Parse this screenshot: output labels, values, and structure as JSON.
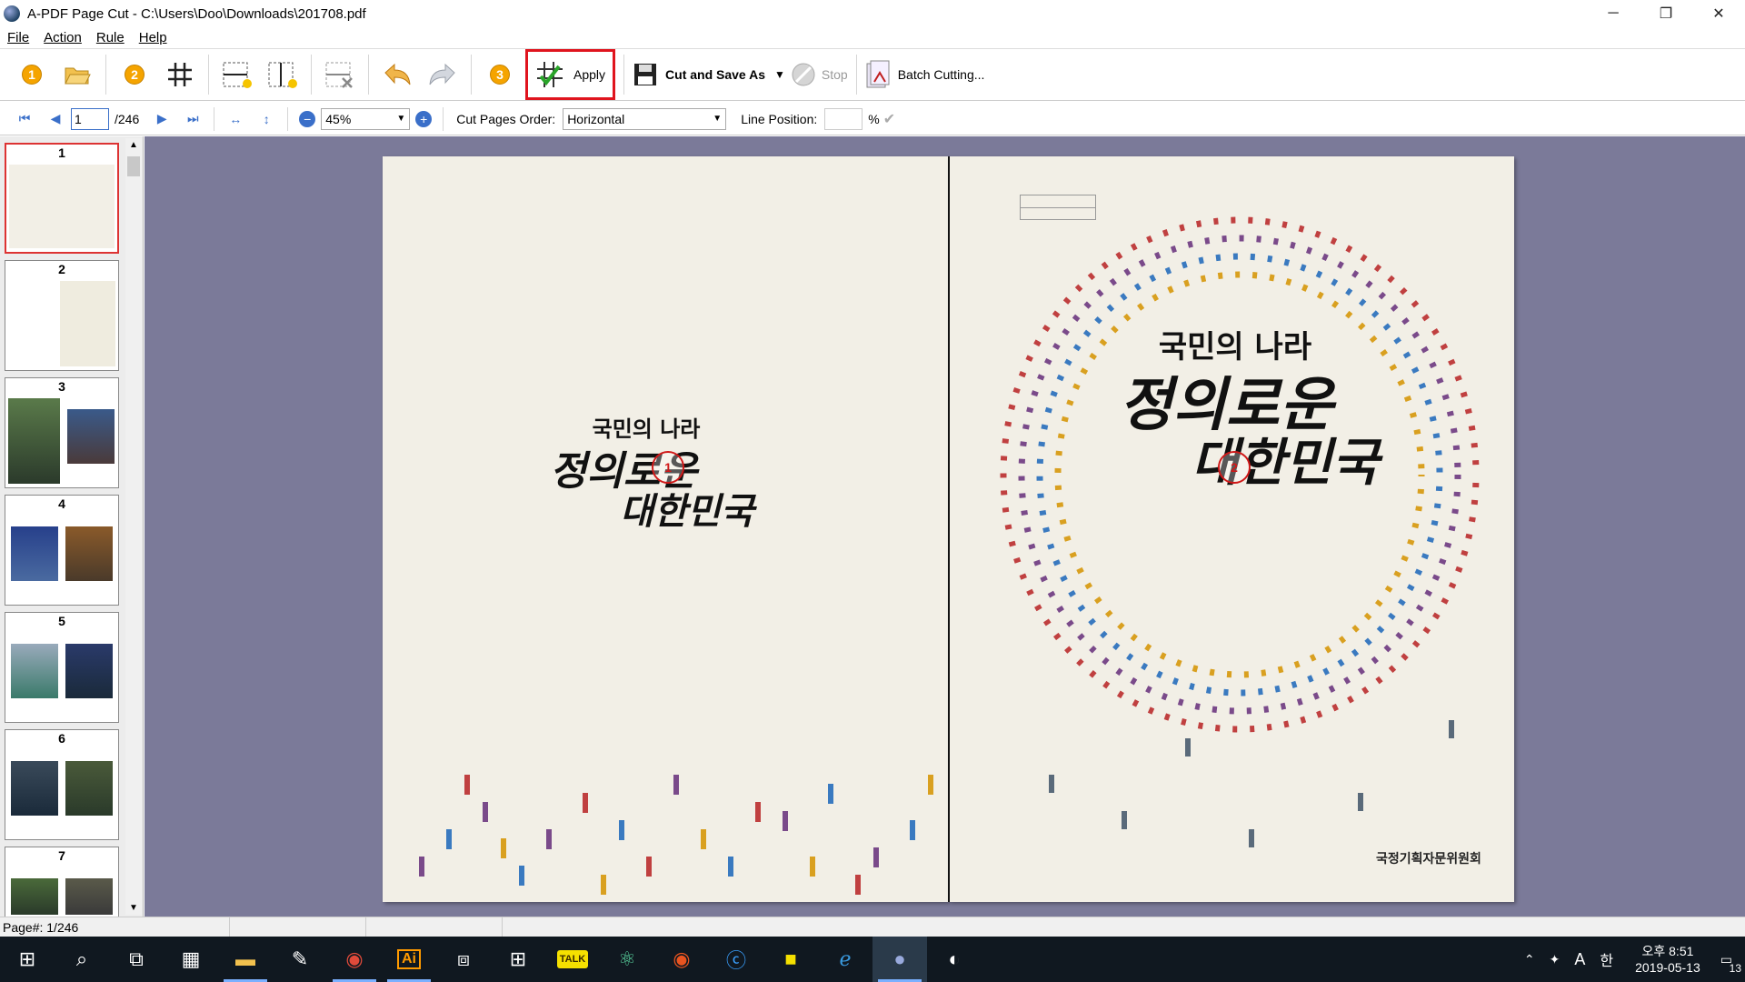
{
  "window": {
    "title": "A-PDF Page Cut - C:\\Users\\Doo\\Downloads\\201708.pdf",
    "minimize": "─",
    "restore": "❐",
    "close": "✕"
  },
  "menu": {
    "items": [
      "File",
      "Action",
      "Rule",
      "Help"
    ]
  },
  "toolbar": {
    "step1": "1",
    "step2": "2",
    "step3": "3",
    "apply": "Apply",
    "cut_and_save": "Cut and Save As",
    "stop": "Stop",
    "batch": "Batch Cutting..."
  },
  "nav": {
    "current_page": "1",
    "total_pages": "/246",
    "zoom": "45%",
    "cut_order_label": "Cut Pages Order:",
    "cut_order_value": "Horizontal",
    "line_position_label": "Line Position:",
    "line_position_value": "",
    "percent": "%"
  },
  "thumbnails": [
    "1",
    "2",
    "3",
    "4",
    "5",
    "6",
    "7"
  ],
  "page": {
    "left_small": "국민의 나라",
    "left_big1": "정의로운",
    "left_big2": "대한민국",
    "right_small": "국민의 나라",
    "right_big1": "정의로운",
    "right_big2": "대한민국",
    "marker1": "1",
    "marker2": "2",
    "publisher": "국정기획자문위원회"
  },
  "status": {
    "page_info": "Page#: 1/246"
  },
  "taskbar": {
    "time": "오후 8:51",
    "date": "2019-05-13",
    "ime_a": "A",
    "ime_han": "한",
    "notifications": "13"
  },
  "colors": {
    "highlight": "#e0141e",
    "canvas": "#7b7a99",
    "page": "#f2efe6",
    "marker": "#d01818"
  }
}
